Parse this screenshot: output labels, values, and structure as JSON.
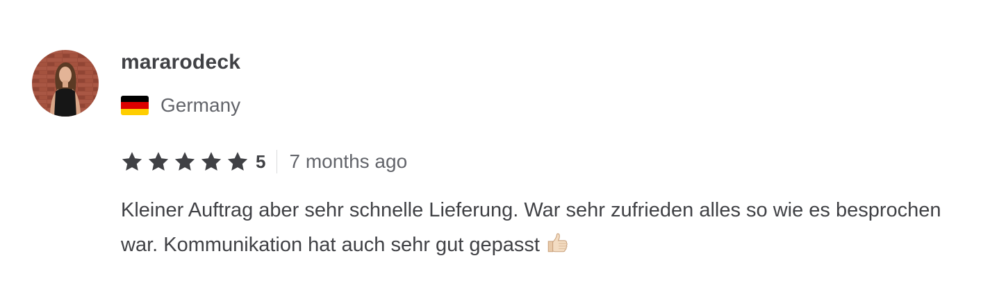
{
  "review": {
    "username": "mararodeck",
    "country": {
      "name": "Germany",
      "flag_colors": [
        "#000000",
        "#dd0000",
        "#ffce00"
      ]
    },
    "rating": {
      "value": "5",
      "stars": 5,
      "max_stars": 5,
      "star_color": "#404145"
    },
    "time_ago": "7 months ago",
    "text": "Kleiner Auftrag aber sehr schnelle Lieferung. War sehr zufrieden alles so wie es besprochen war. Kommunikation hat auch sehr gut gepasst",
    "emoji": "thumbs-up-icon"
  }
}
